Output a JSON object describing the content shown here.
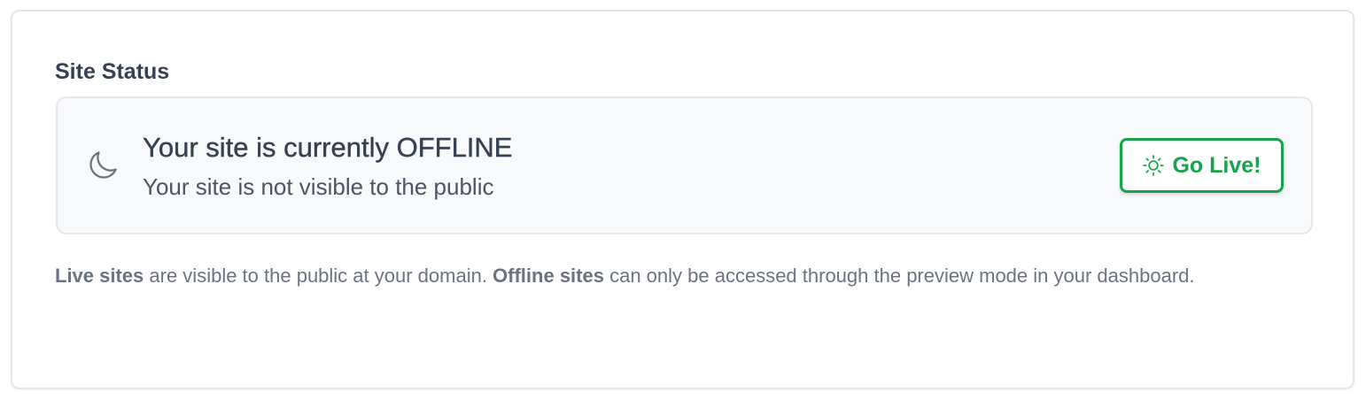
{
  "site_status": {
    "title": "Site Status",
    "status_icon": "moon-icon",
    "heading": "Your site is currently OFFLINE",
    "subtext": "Your site is not visible to the public",
    "button": {
      "icon": "sun-icon",
      "label": "Go Live!"
    },
    "help": {
      "live_term": "Live sites",
      "live_desc": " are visible to the public at your domain. ",
      "offline_term": "Offline sites",
      "offline_desc": " can only be accessed through the preview mode in your dashboard."
    }
  },
  "colors": {
    "accent_green": "#16a34a",
    "text_dark": "#374151",
    "text_muted": "#6b7280",
    "panel_bg": "#f8f9fb",
    "border": "#e5e7eb"
  }
}
